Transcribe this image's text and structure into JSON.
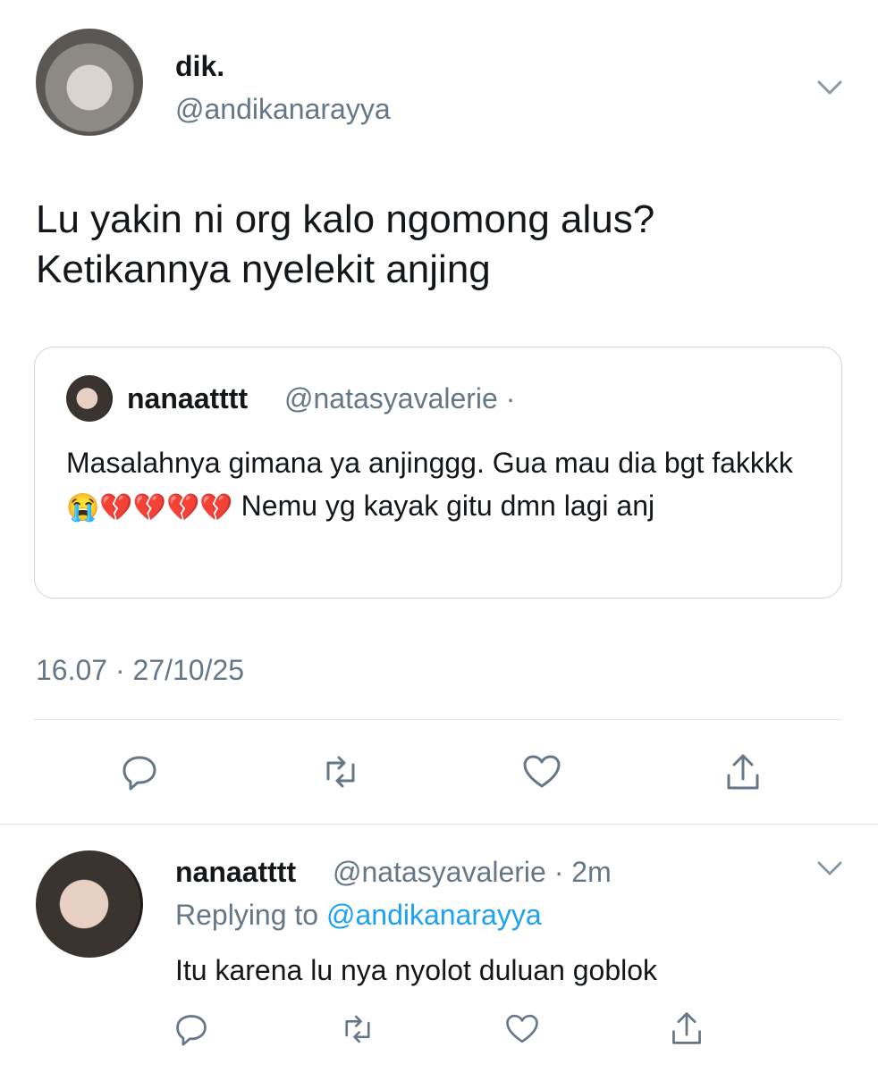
{
  "tweet": {
    "display_name": "dik.",
    "handle": "@andikanarayya",
    "text_line1": "Lu yakin ni org kalo ngomong alus?",
    "text_line2": "Ketikannya nyelekit anjing",
    "timestamp": "16.07 · 27/10/25"
  },
  "quote": {
    "display_name": "nanaatttt",
    "handle": "@natasyavalerie ·",
    "text_part1": "Masalahnya gimana ya anjinggg. Gua mau dia bgt fakkkk",
    "emojis": "😭💔💔💔💔",
    "text_part2": " Nemu yg kayak gitu dmn lagi anj"
  },
  "reply": {
    "display_name": "nanaatttt",
    "handle": "@natasyavalerie · 2m",
    "replying_prefix": "Replying to ",
    "replying_handle": "@andikanarayya",
    "text": "Itu karena lu nya nyolot duluan goblok"
  },
  "icons": {
    "menu": "chevron-down-icon",
    "reply": "reply-icon",
    "retweet": "retweet-icon",
    "like": "heart-icon",
    "share": "share-icon"
  },
  "colors": {
    "text": "#14171a",
    "secondary": "#657786",
    "link": "#1da1f2",
    "border": "#ccd6dd"
  }
}
